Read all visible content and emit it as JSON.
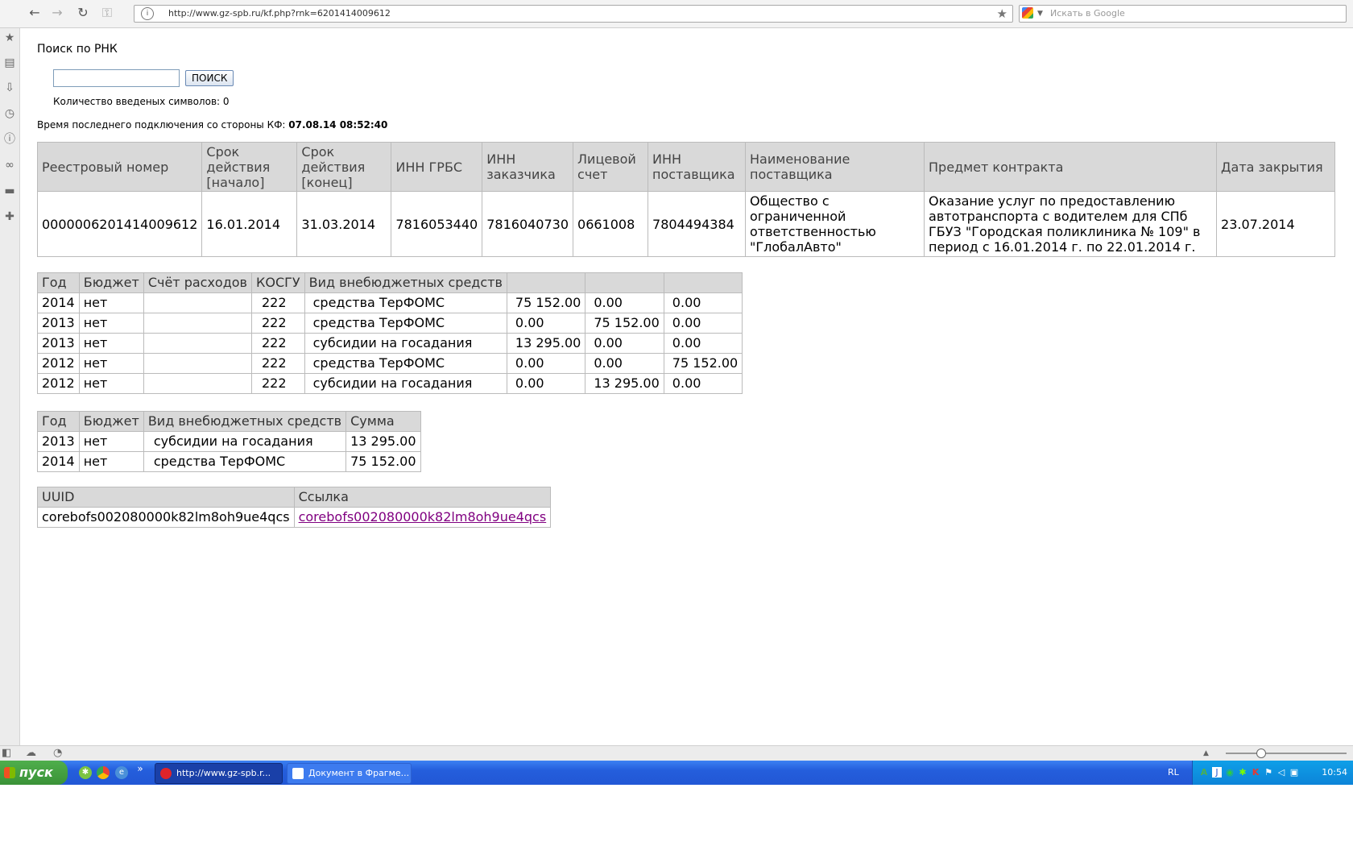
{
  "browser": {
    "url": "http://www.gz-spb.ru/kf.php?rnk=6201414009612",
    "search_placeholder": "Искать в Google"
  },
  "page": {
    "search_title": "Поиск по РНК",
    "input_value": "",
    "search_button": "ПОИСК",
    "char_count_label": "Количество введеных символов: 0",
    "last_connection_label": "Время последнего подключения со стороны КФ:",
    "last_connection_value": "07.08.14 08:52:40"
  },
  "contract_table": {
    "headers": [
      "Реестровый номер",
      "Срок действия [начало]",
      "Срок действия [конец]",
      "ИНН ГРБС",
      "ИНН заказчика",
      "Лицевой счет",
      "ИНН поставщика",
      "Наименование поставщика",
      "Предмет контракта",
      "Дата закрытия"
    ],
    "row": [
      "0000006201414009612",
      "16.01.2014",
      "31.03.2014",
      "7816053440",
      "7816040730",
      "0661008",
      "7804494384",
      "Общество с ограниченной ответственностью \"ГлобалАвто\"",
      "Оказание услуг по предоставлению автотранспорта с водителем для СПб ГБУЗ \"Городская поликлиника № 109\" в период с 16.01.2014 г. по 22.01.2014 г.",
      "23.07.2014"
    ]
  },
  "finance_table": {
    "headers": [
      "Год",
      "Бюджет",
      "Счёт расходов",
      "КОСГУ",
      "Вид внебюджетных средств",
      "",
      "",
      ""
    ],
    "rows": [
      [
        "2014",
        "нет",
        "",
        "222",
        "средства ТерФОМС",
        "75 152.00",
        "0.00",
        "0.00"
      ],
      [
        "2013",
        "нет",
        "",
        "222",
        "средства ТерФОМС",
        "0.00",
        "75 152.00",
        "0.00"
      ],
      [
        "2013",
        "нет",
        "",
        "222",
        "субсидии на госадания",
        "13 295.00",
        "0.00",
        "0.00"
      ],
      [
        "2012",
        "нет",
        "",
        "222",
        "средства ТерФОМС",
        "0.00",
        "0.00",
        "75 152.00"
      ],
      [
        "2012",
        "нет",
        "",
        "222",
        "субсидии на госадания",
        "0.00",
        "13 295.00",
        "0.00"
      ]
    ]
  },
  "summary_table": {
    "headers": [
      "Год",
      "Бюджет",
      "Вид внебюджетных средств",
      "Сумма"
    ],
    "rows": [
      [
        "2013",
        "нет",
        "субсидии на госадания",
        "13 295.00"
      ],
      [
        "2014",
        "нет",
        "средства ТерФОМС",
        "75 152.00"
      ]
    ]
  },
  "uuid_table": {
    "headers": [
      "UUID",
      "Ссылка"
    ],
    "uuid": "corebofs002080000k82lm8oh9ue4qcs",
    "link": "corebofs002080000k82lm8oh9ue4qcs"
  },
  "taskbar": {
    "start_label": "пуск",
    "tasks": [
      "http://www.gz-spb.r...",
      "Документ в Фрагме..."
    ],
    "lang": "RL",
    "clock": "10:54"
  }
}
